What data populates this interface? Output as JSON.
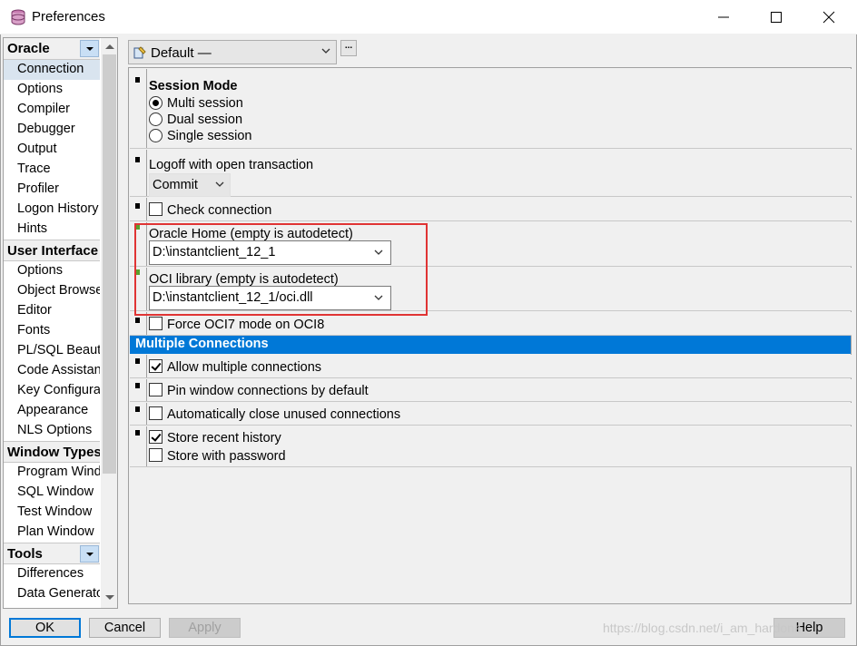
{
  "window": {
    "title": "Preferences",
    "icon": "database-icon"
  },
  "profile": {
    "selected": "Default —",
    "more_label": "..."
  },
  "sidebar": {
    "groups": [
      {
        "label": "Oracle",
        "items": [
          "Connection",
          "Options",
          "Compiler",
          "Debugger",
          "Output",
          "Trace",
          "Profiler",
          "Logon History",
          "Hints"
        ]
      },
      {
        "label": "User Interface",
        "items": [
          "Options",
          "Object Browser",
          "Editor",
          "Fonts",
          "PL/SQL Beautifier",
          "Code Assistant",
          "Key Configuration",
          "Appearance",
          "NLS Options"
        ]
      },
      {
        "label": "Window Types",
        "items": [
          "Program Window",
          "SQL Window",
          "Test Window",
          "Plan Window"
        ]
      },
      {
        "label": "Tools",
        "items": [
          "Differences",
          "Data Generator"
        ]
      }
    ],
    "selected": "Connection"
  },
  "session_mode": {
    "title": "Session Mode",
    "options": [
      "Multi session",
      "Dual session",
      "Single session"
    ],
    "selected": "Multi session"
  },
  "logoff": {
    "label": "Logoff with open transaction",
    "value": "Commit"
  },
  "check_connection": {
    "label": "Check connection",
    "checked": false
  },
  "oracle_home": {
    "label": "Oracle Home (empty is autodetect)",
    "value": "D:\\instantclient_12_1"
  },
  "oci_library": {
    "label": "OCI library (empty is autodetect)",
    "value": "D:\\instantclient_12_1/oci.dll"
  },
  "force_oci7": {
    "label": "Force OCI7 mode on OCI8",
    "checked": false
  },
  "multiple_connections": {
    "header": "Multiple Connections",
    "allow": {
      "label": "Allow multiple connections",
      "checked": true
    },
    "pin": {
      "label": "Pin window connections by default",
      "checked": false
    },
    "autoclose": {
      "label": "Automatically close unused connections",
      "checked": false
    },
    "store_history": {
      "label": "Store recent history",
      "checked": true
    },
    "store_password": {
      "label": "Store with password",
      "checked": false
    }
  },
  "buttons": {
    "ok": "OK",
    "cancel": "Cancel",
    "apply": "Apply",
    "help": "Help"
  },
  "watermark": "https://blog.csdn.net/i_am_hardone",
  "colors": {
    "accent": "#0078d7",
    "highlight_box": "#e03434"
  }
}
